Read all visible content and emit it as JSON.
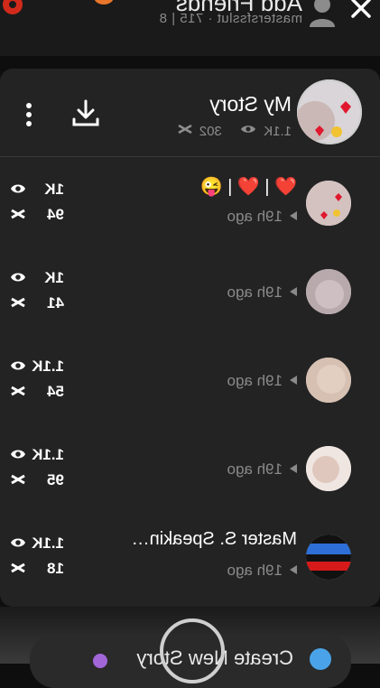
{
  "header": {
    "title": "Add Friends",
    "subtitle": "mastersfsslut · 715 | 8"
  },
  "my_story": {
    "title": "My Story",
    "views": "1.1K",
    "screenshots": "302"
  },
  "snaps": [
    {
      "title": "❤️ | ❤️ | 😜",
      "time": "19h ago",
      "views": "1K",
      "screenshots": "94"
    },
    {
      "title": "",
      "time": "19h ago",
      "views": "1K",
      "screenshots": "41"
    },
    {
      "title": "",
      "time": "19h ago",
      "views": "1.1K",
      "screenshots": "54"
    },
    {
      "title": "",
      "time": "19h ago",
      "views": "1.1K",
      "screenshots": "95"
    },
    {
      "title": "Master S. Speakin…",
      "time": "19h ago",
      "views": "1.1K",
      "screenshots": "18"
    }
  ],
  "footer": {
    "create_label": "Create New Story"
  },
  "colors": {
    "background": "#0e0e0e",
    "card": "#232323",
    "muted_text": "#8a8a8a",
    "accent_red": "#e0182d"
  }
}
